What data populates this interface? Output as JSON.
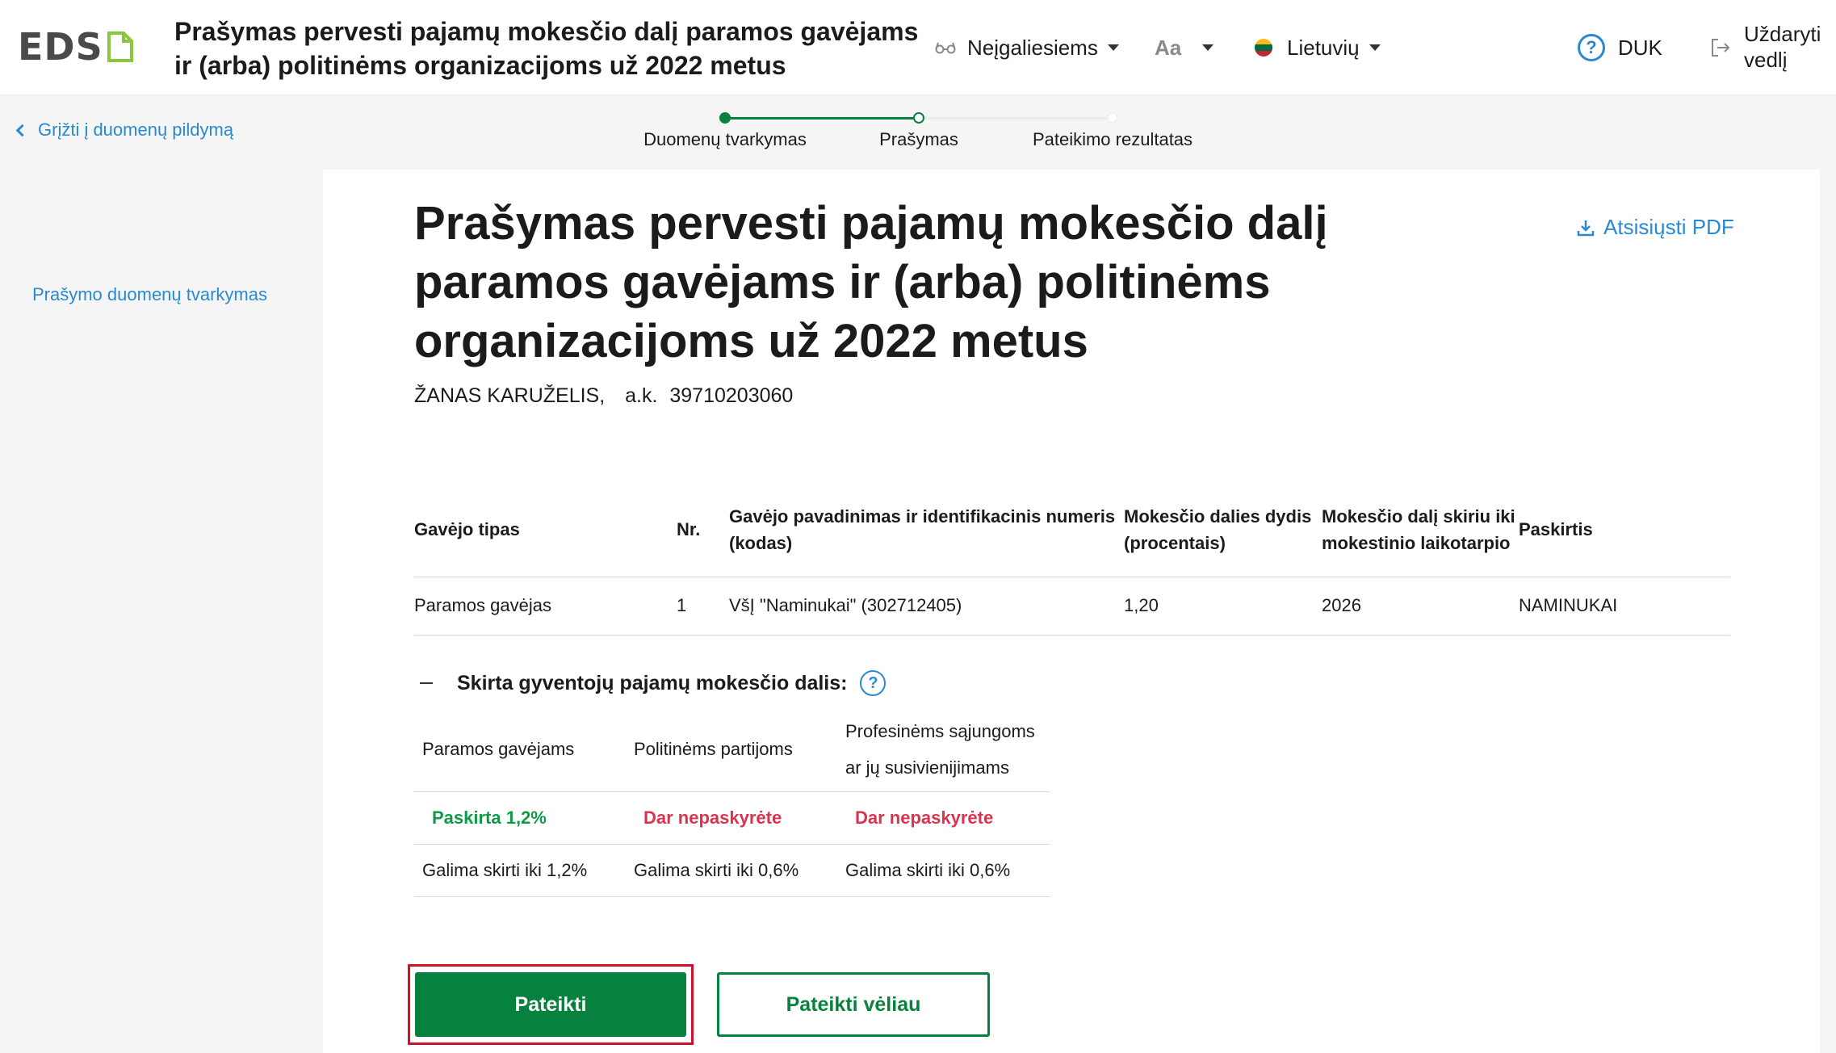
{
  "header": {
    "logo_text": "EDS",
    "title": "Prašymas pervesti pajamų mokesčio dalį paramos gavėjams ir (arba) politinėms organizacijoms už 2022 metus",
    "accessibility_label": "Neįgaliesiems",
    "font_size_label": "Aa",
    "language_label": "Lietuvių",
    "help_label": "DUK",
    "close_label": "Uždaryti vedlį",
    "brand_green": "#8cc63f"
  },
  "subbar": {
    "back_label": "Grįžti į duomenų pildymą",
    "steps": [
      {
        "label": "Duomenų tvarkymas",
        "state": "done"
      },
      {
        "label": "Prašymas",
        "state": "current"
      },
      {
        "label": "Pateikimo rezultatas",
        "state": "pending"
      }
    ]
  },
  "sidebar": {
    "link_label": "Prašymo duomenų tvarkymas"
  },
  "main": {
    "title": "Prašymas pervesti pajamų mokesčio dalį paramos gavėjams ir (arba) politinėms organizacijoms už 2022 metus",
    "pdf_label": "Atsisiųsti PDF",
    "person_name": "ŽANAS KARUŽELIS,",
    "person_code_label": "a.k.",
    "person_code": "39710203060",
    "table": {
      "headers": [
        "Gavėjo tipas",
        "Nr.",
        "Gavėjo pavadinimas ir identifikacinis numeris (kodas)",
        "Mokesčio dalies dydis (procentais)",
        "Mokesčio dalį skiriu iki mokestinio laikotarpio",
        "Paskirtis"
      ],
      "rows": [
        [
          "Paramos gavėjas",
          "1",
          "VšĮ \"Naminukai\" (302712405)",
          "1,20",
          "2026",
          "NAMINUKAI"
        ]
      ]
    },
    "share": {
      "title": "Skirta gyventojų pajamų mokesčio dalis:",
      "headers": [
        "Paramos gavėjams",
        "Politinėms partijoms",
        "Profesinėms sąjungoms ar jų susivienijimams"
      ],
      "status": [
        "Paskirta 1,2%",
        "Dar nepaskyrėte",
        "Dar nepaskyrėte"
      ],
      "limits": [
        "Galima skirti iki 1,2%",
        "Galima skirti iki 0,6%",
        "Galima skirti iki 0,6%"
      ]
    },
    "buttons": {
      "submit": "Pateikti",
      "submit_later": "Pateikti vėliau"
    },
    "colors": {
      "primary_green": "#07813e",
      "link_blue": "#2a8ad0",
      "status_green": "#0f9a48",
      "status_red": "#d9334f",
      "highlight_red": "#d0112b"
    }
  }
}
